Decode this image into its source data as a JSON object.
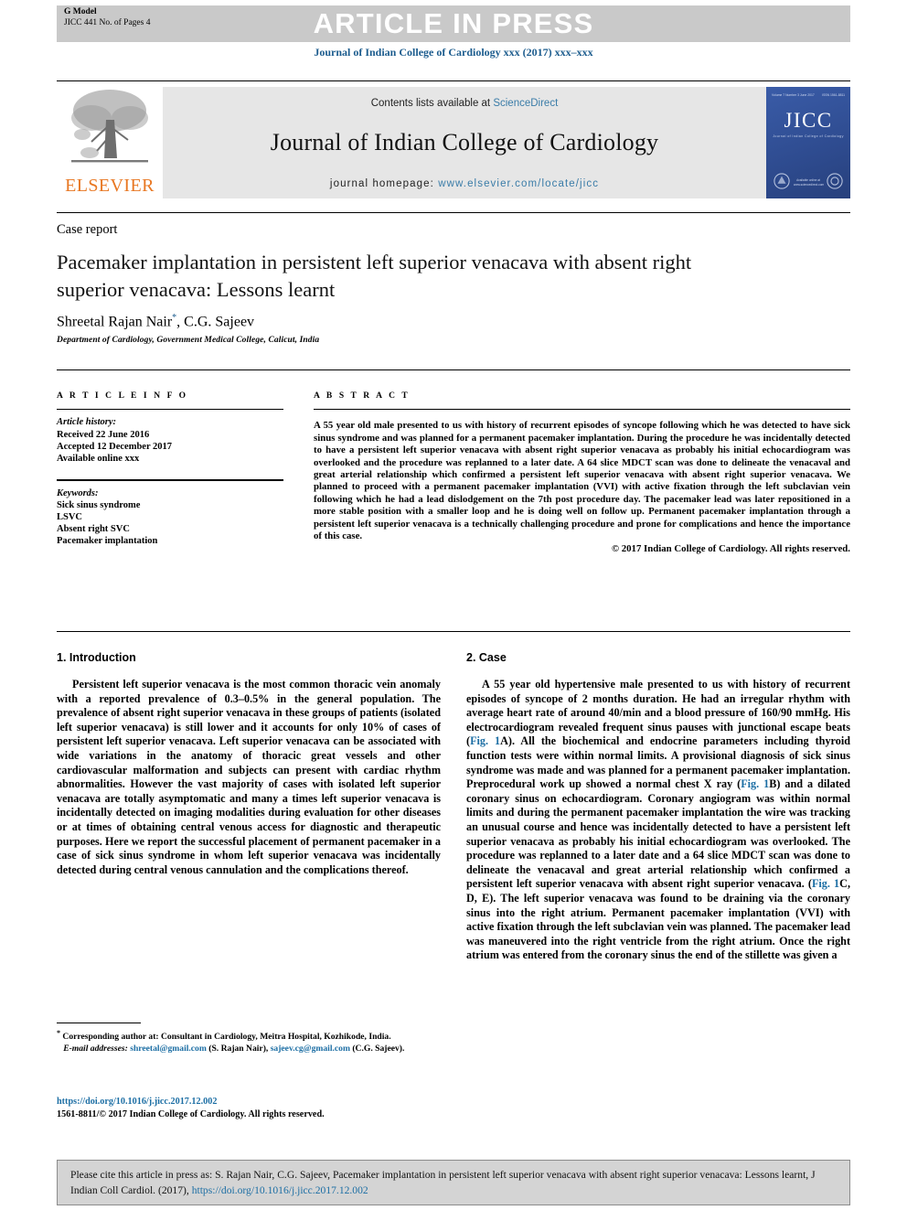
{
  "header": {
    "g_model": "G Model",
    "article_no": "JICC 441 No. of Pages 4",
    "article_in_press": "ARTICLE IN PRESS",
    "journal_citation": "Journal of Indian College of Cardiology xxx (2017) xxx–xxx"
  },
  "masthead": {
    "contents_prefix": "Contents lists available at",
    "sciencedirect": "ScienceDirect",
    "journal_name": "Journal of Indian College of Cardiology",
    "homepage_label": "journal homepage:",
    "homepage_url": "www.elsevier.com/locate/jicc",
    "publisher": "ELSEVIER",
    "cover": {
      "title": "JICC",
      "subtitle": "Journal of Indian College of Cardiology",
      "top_left": "Volume 7  Number 3  June 2017",
      "top_right": "ISSN 1561-8811",
      "footer": "Available online at\nwww.sciencedirect.com"
    }
  },
  "article": {
    "type_label": "Case report",
    "title": "Pacemaker implantation in persistent left superior venacava with absent right superior venacava: Lessons learnt",
    "authors": "Shreetal Rajan Nair",
    "authors_rest": ", C.G. Sajeev",
    "corresponding_mark": "*",
    "affiliation": "Department of Cardiology, Government Medical College, Calicut, India"
  },
  "article_info": {
    "heading": "A R T I C L E   I N F O",
    "history_label": "Article history:",
    "received": "Received 22 June 2016",
    "accepted": "Accepted 12 December 2017",
    "available": "Available online xxx",
    "keywords_label": "Keywords:",
    "keywords": [
      "Sick sinus syndrome",
      "LSVC",
      "Absent right SVC",
      "Pacemaker implantation"
    ]
  },
  "abstract": {
    "heading": "A B S T R A C T",
    "text": "A 55 year old male presented to us with history of recurrent episodes of syncope following which he was detected to have sick sinus syndrome and was planned for a permanent pacemaker implantation. During the procedure he was incidentally detected to have a persistent left superior venacava with absent right superior venacava as probably his initial echocardiogram was overlooked and the procedure was replanned to a later date. A 64 slice MDCT scan was done to delineate the venacaval and great arterial relationship which confirmed a persistent left superior venacava with absent right superior venacava. We planned to proceed with a permanent pacemaker implantation (VVI) with active fixation through the left subclavian vein following which he had a lead dislodgement on the 7th post procedure day. The pacemaker lead was later repositioned in a more stable position with a smaller loop and he is doing well on follow up. Permanent pacemaker implantation through a persistent left superior venacava is a technically challenging procedure and prone for complications and hence the importance of this case.",
    "copyright": "© 2017 Indian College of Cardiology. All rights reserved."
  },
  "sections": {
    "introduction": {
      "heading": "1. Introduction",
      "paragraph": "Persistent left superior venacava is the most common thoracic vein anomaly with a reported prevalence of 0.3–0.5% in the general population. The prevalence of absent right superior venacava in these groups of patients (isolated left superior venacava) is still lower and it accounts for only 10% of cases of persistent left superior venacava. Left superior venacava can be associated with wide variations in the anatomy of thoracic great vessels and other cardiovascular malformation and subjects can present with cardiac rhythm abnormalities. However the vast majority of cases with isolated left superior venacava are totally asymptomatic and many a times left superior venacava is incidentally detected on imaging modalities during evaluation for other diseases or at times of obtaining central venous access for diagnostic and therapeutic purposes. Here we report the successful placement of permanent pacemaker in a case of sick sinus syndrome in whom left superior venacava was incidentally detected during central venous cannulation and the complications thereof."
    },
    "case": {
      "heading": "2. Case",
      "p1_a": "A 55 year old hypertensive male presented to us with history of recurrent episodes of syncope of 2 months duration. He had an irregular rhythm with average heart rate of around 40/min and a blood pressure of 160/90 mmHg. His electrocardiogram revealed frequent sinus pauses with junctional escape beats (",
      "fig1a": "Fig. 1",
      "p1_b": "A). All the biochemical and endocrine parameters including thyroid function tests were within normal limits. A provisional diagnosis of sick sinus syndrome was made and was planned for a permanent pacemaker implantation. Preprocedural work up showed a normal chest X ray (",
      "fig1b": "Fig. 1",
      "p1_c": "B) and a dilated coronary sinus on echocardiogram. Coronary angiogram was within normal limits and during the permanent pacemaker implantation the wire was tracking an unusual course and hence was incidentally detected to have a persistent left superior venacava as probably his initial echocardiogram was overlooked. The procedure was replanned to a later date and a 64 slice MDCT scan was done to delineate the venacaval and great arterial relationship which confirmed a persistent left superior venacava with absent right superior venacava. (",
      "fig1c": "Fig. 1",
      "p1_d": "C, D, E). The left superior venacava was found to be draining via the coronary sinus into the right atrium. Permanent pacemaker implantation (VVI) with active fixation through the left subclavian vein was planned. The pacemaker lead was maneuvered into the right ventricle from the right atrium. Once the right atrium was entered from the coronary sinus the end of the stillette was given a"
    }
  },
  "footnotes": {
    "corresponding_mark": "*",
    "corresponding": "Corresponding author at: Consultant in Cardiology, Meitra Hospital, Kozhikode, India.",
    "email_label": "E-mail addresses:",
    "email1": "shreetal@gmail.com",
    "email1_owner": "(S. Rajan Nair),",
    "email2": "sajeev.cg@gmail.com",
    "email2_owner": "(C.G. Sajeev).",
    "doi": "https://doi.org/10.1016/j.jicc.2017.12.002",
    "issn_line": "1561-8811/© 2017 Indian College of Cardiology. All rights reserved."
  },
  "cite_box": {
    "prefix": "Please cite this article in press as: S. Rajan Nair, C.G. Sajeev, Pacemaker implantation in persistent left superior venacava with absent right superior venacava: Lessons learnt, J Indian Coll Cardiol. (2017),",
    "link": "https://doi.org/10.1016/j.jicc.2017.12.002"
  },
  "colors": {
    "link_blue": "#1c6ea4",
    "journal_blue": "#1c5c8e",
    "elsevier_orange": "#e87722",
    "band_gray": "#c9c9c9",
    "cover_blue": "#33539b"
  }
}
